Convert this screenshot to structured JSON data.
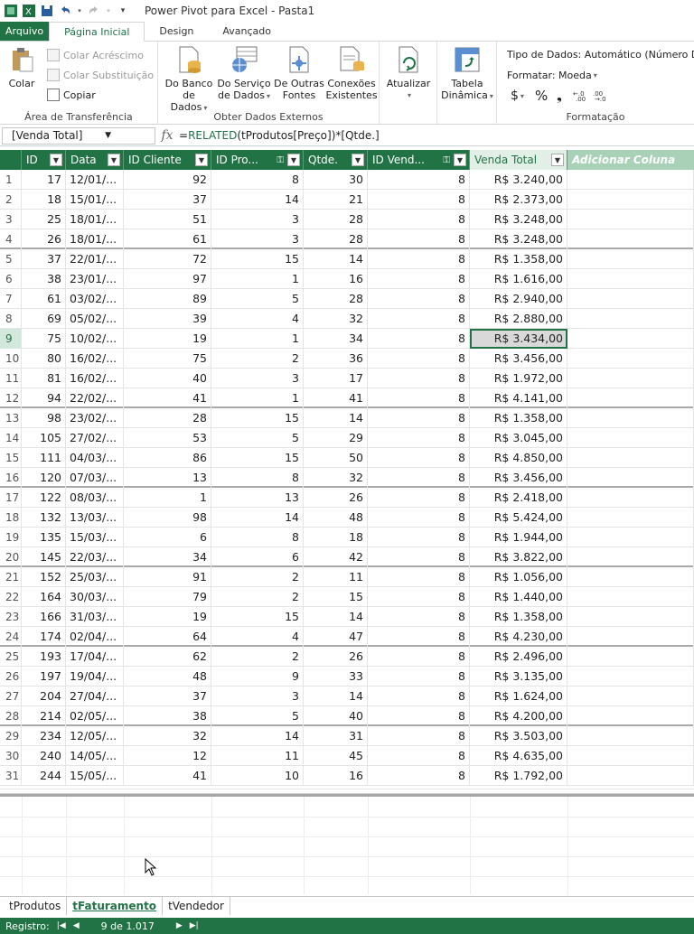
{
  "window": {
    "title": "Power Pivot para Excel - Pasta1"
  },
  "ribbon_tabs": [
    "Arquivo",
    "Página Inicial",
    "Design",
    "Avançado"
  ],
  "ribbon": {
    "clipboard": {
      "label": "Área de Transferência",
      "paste": "Colar",
      "paste_append": "Colar Acréscimo",
      "paste_replace": "Colar Substituição",
      "copy": "Copiar"
    },
    "external_data": {
      "label": "Obter Dados Externos",
      "from_database": [
        "Do Banco",
        "de Dados"
      ],
      "from_data_service": [
        "Do Serviço",
        "de Dados"
      ],
      "from_other_sources": [
        "De Outras",
        "Fontes"
      ],
      "existing_connections": [
        "Conexões",
        "Existentes"
      ]
    },
    "refresh": "Atualizar",
    "pivot_table": [
      "Tabela",
      "Dinâmica"
    ],
    "formatting": {
      "label": "Formatação",
      "data_type": "Tipo de Dados: Automático (Número Dec",
      "format": "Formatar: Moeda",
      "currency_symbol": "$",
      "percent_symbol": "%",
      "comma_symbol": "❟"
    }
  },
  "formula_bar": {
    "name_box": "[Venda Total]",
    "fx": "fx",
    "formula_prefix": "=",
    "formula_fn": "RELATED",
    "formula_rest": "(tProdutos[Preço])*[Qtde.]"
  },
  "columns": [
    {
      "label": "ID",
      "key": true
    },
    {
      "label": "Data"
    },
    {
      "label": "ID Cliente"
    },
    {
      "label": "ID Pro..."
    },
    {
      "label": "Qtde."
    },
    {
      "label": "ID Vend..."
    },
    {
      "label": "Venda Total"
    },
    {
      "label": "Adicionar Coluna"
    }
  ],
  "rows": [
    {
      "n": "1",
      "id": "17",
      "data": "12/01/...",
      "cli": "92",
      "prod": "8",
      "qtde": "30",
      "vend": "8",
      "total": "R$ 3.240,00"
    },
    {
      "n": "2",
      "id": "18",
      "data": "15/01/...",
      "cli": "37",
      "prod": "14",
      "qtde": "21",
      "vend": "8",
      "total": "R$ 2.373,00"
    },
    {
      "n": "3",
      "id": "25",
      "data": "18/01/...",
      "cli": "51",
      "prod": "3",
      "qtde": "28",
      "vend": "8",
      "total": "R$ 3.248,00"
    },
    {
      "n": "4",
      "id": "26",
      "data": "18/01/...",
      "cli": "61",
      "prod": "3",
      "qtde": "28",
      "vend": "8",
      "total": "R$ 3.248,00"
    },
    {
      "n": "5",
      "id": "37",
      "data": "22/01/...",
      "cli": "72",
      "prod": "15",
      "qtde": "14",
      "vend": "8",
      "total": "R$ 1.358,00"
    },
    {
      "n": "6",
      "id": "38",
      "data": "23/01/...",
      "cli": "97",
      "prod": "1",
      "qtde": "16",
      "vend": "8",
      "total": "R$ 1.616,00"
    },
    {
      "n": "7",
      "id": "61",
      "data": "03/02/...",
      "cli": "89",
      "prod": "5",
      "qtde": "28",
      "vend": "8",
      "total": "R$ 2.940,00"
    },
    {
      "n": "8",
      "id": "69",
      "data": "05/02/...",
      "cli": "39",
      "prod": "4",
      "qtde": "32",
      "vend": "8",
      "total": "R$ 2.880,00"
    },
    {
      "n": "9",
      "id": "75",
      "data": "10/02/...",
      "cli": "19",
      "prod": "1",
      "qtde": "34",
      "vend": "8",
      "total": "R$ 3.434,00"
    },
    {
      "n": "10",
      "id": "80",
      "data": "16/02/...",
      "cli": "75",
      "prod": "2",
      "qtde": "36",
      "vend": "8",
      "total": "R$ 3.456,00"
    },
    {
      "n": "11",
      "id": "81",
      "data": "16/02/...",
      "cli": "40",
      "prod": "3",
      "qtde": "17",
      "vend": "8",
      "total": "R$ 1.972,00"
    },
    {
      "n": "12",
      "id": "94",
      "data": "22/02/...",
      "cli": "41",
      "prod": "1",
      "qtde": "41",
      "vend": "8",
      "total": "R$ 4.141,00"
    },
    {
      "n": "13",
      "id": "98",
      "data": "23/02/...",
      "cli": "28",
      "prod": "15",
      "qtde": "14",
      "vend": "8",
      "total": "R$ 1.358,00"
    },
    {
      "n": "14",
      "id": "105",
      "data": "27/02/...",
      "cli": "53",
      "prod": "5",
      "qtde": "29",
      "vend": "8",
      "total": "R$ 3.045,00"
    },
    {
      "n": "15",
      "id": "111",
      "data": "04/03/...",
      "cli": "86",
      "prod": "15",
      "qtde": "50",
      "vend": "8",
      "total": "R$ 4.850,00"
    },
    {
      "n": "16",
      "id": "120",
      "data": "07/03/...",
      "cli": "13",
      "prod": "8",
      "qtde": "32",
      "vend": "8",
      "total": "R$ 3.456,00"
    },
    {
      "n": "17",
      "id": "122",
      "data": "08/03/...",
      "cli": "1",
      "prod": "13",
      "qtde": "26",
      "vend": "8",
      "total": "R$ 2.418,00"
    },
    {
      "n": "18",
      "id": "132",
      "data": "13/03/...",
      "cli": "98",
      "prod": "14",
      "qtde": "48",
      "vend": "8",
      "total": "R$ 5.424,00"
    },
    {
      "n": "19",
      "id": "135",
      "data": "15/03/...",
      "cli": "6",
      "prod": "8",
      "qtde": "18",
      "vend": "8",
      "total": "R$ 1.944,00"
    },
    {
      "n": "20",
      "id": "145",
      "data": "22/03/...",
      "cli": "34",
      "prod": "6",
      "qtde": "42",
      "vend": "8",
      "total": "R$ 3.822,00"
    },
    {
      "n": "21",
      "id": "152",
      "data": "25/03/...",
      "cli": "91",
      "prod": "2",
      "qtde": "11",
      "vend": "8",
      "total": "R$ 1.056,00"
    },
    {
      "n": "22",
      "id": "164",
      "data": "30/03/...",
      "cli": "79",
      "prod": "2",
      "qtde": "15",
      "vend": "8",
      "total": "R$ 1.440,00"
    },
    {
      "n": "23",
      "id": "166",
      "data": "31/03/...",
      "cli": "19",
      "prod": "15",
      "qtde": "14",
      "vend": "8",
      "total": "R$ 1.358,00"
    },
    {
      "n": "24",
      "id": "174",
      "data": "02/04/...",
      "cli": "64",
      "prod": "4",
      "qtde": "47",
      "vend": "8",
      "total": "R$ 4.230,00"
    },
    {
      "n": "25",
      "id": "193",
      "data": "17/04/...",
      "cli": "62",
      "prod": "2",
      "qtde": "26",
      "vend": "8",
      "total": "R$ 2.496,00"
    },
    {
      "n": "26",
      "id": "197",
      "data": "19/04/...",
      "cli": "48",
      "prod": "9",
      "qtde": "33",
      "vend": "8",
      "total": "R$ 3.135,00"
    },
    {
      "n": "27",
      "id": "204",
      "data": "27/04/...",
      "cli": "37",
      "prod": "3",
      "qtde": "14",
      "vend": "8",
      "total": "R$ 1.624,00"
    },
    {
      "n": "28",
      "id": "214",
      "data": "02/05/...",
      "cli": "38",
      "prod": "5",
      "qtde": "40",
      "vend": "8",
      "total": "R$ 4.200,00"
    },
    {
      "n": "29",
      "id": "234",
      "data": "12/05/...",
      "cli": "32",
      "prod": "14",
      "qtde": "31",
      "vend": "8",
      "total": "R$ 3.503,00"
    },
    {
      "n": "30",
      "id": "240",
      "data": "14/05/...",
      "cli": "12",
      "prod": "11",
      "qtde": "45",
      "vend": "8",
      "total": "R$ 4.635,00"
    },
    {
      "n": "31",
      "id": "244",
      "data": "15/05/...",
      "cli": "41",
      "prod": "10",
      "qtde": "16",
      "vend": "8",
      "total": "R$ 1.792,00"
    }
  ],
  "selected_row": "9",
  "sheet_tabs": [
    "tProdutos",
    "tFaturamento",
    "tVendedor"
  ],
  "active_sheet": "tFaturamento",
  "status": {
    "label": "Registro:",
    "position": "9 de 1.017"
  },
  "colors": {
    "accent": "#217346",
    "header_calc": "#e2efe7",
    "header_add": "#a9d1b8"
  }
}
